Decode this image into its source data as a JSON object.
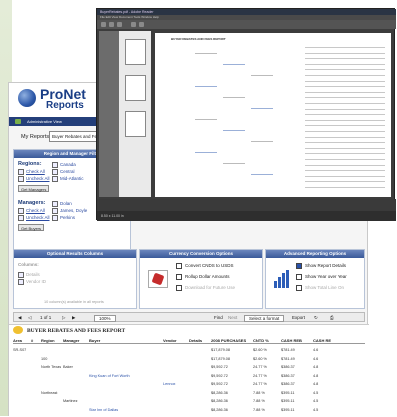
{
  "app": {
    "logo_text": "ProNet",
    "logo_sub": "Reports",
    "admin_label": "Administrative View",
    "my_reports_label": "My Reports:",
    "report_select_value": "Buyer Rebates and Fees"
  },
  "region_panel": {
    "title": "Region and Manager Filter",
    "regions_label": "Regions:",
    "regions": [
      "Canada",
      "Central",
      "Mid-Atlantic"
    ],
    "region_links": [
      "Check All",
      "Uncheck All"
    ],
    "regions_button": "Get Managers",
    "managers_label": "Managers:",
    "managers": [
      "Dolan",
      "James, Doyle",
      "Perkins"
    ],
    "manager_links": [
      "Check All",
      "Uncheck All"
    ],
    "managers_button": "Get Buyers"
  },
  "options": {
    "optional_title": "Optional Results Columns",
    "columns_label": "Columns:",
    "columns": [
      "Details",
      "Vendor ID"
    ],
    "optional_note": "10 column(s) available in all reports",
    "currency_title": "Currency Conversion Options",
    "currency_checks": [
      "Convert CNDS to USDS",
      "Rollup Dollar Amounts",
      "Download for Future Use"
    ],
    "advanced_title": "Advanced Reporting Options",
    "advanced_checks": [
      "Show Report Details",
      "Show Year over Year",
      "Show Total Line On"
    ]
  },
  "toolbar": {
    "page_info": "1 of 1",
    "zoom": "100%",
    "find": "Find",
    "next": "Next",
    "format": "Select a format",
    "export": "Export"
  },
  "report": {
    "title": "BUYER REBATES AND FEES REPORT",
    "columns": [
      "Area",
      "#",
      "Region",
      "Manager",
      "Buyer",
      "Vendor",
      "Details",
      "2008 PURCHASES",
      "CNTD %",
      "CASH REB",
      "CASH RE"
    ],
    "rows": [
      {
        "area": "SR-S07",
        "region": "",
        "manager": "",
        "buyer": "",
        "vendor": "",
        "purchases": "$17,879.08",
        "cntd": "$2.60 %",
        "cash": "$781.49",
        "cash2": "4.6"
      },
      {
        "area": "",
        "region": "100",
        "manager": "",
        "buyer": "",
        "vendor": "",
        "purchases": "$17,879.08",
        "cntd": "$2.60 %",
        "cash": "$781.49",
        "cash2": "4.6"
      },
      {
        "area": "",
        "region": "North Texas",
        "manager": "Baker",
        "buyer": "",
        "vendor": "",
        "purchases": "$9,592.72",
        "cntd": "24.77 %",
        "cash": "$386.37",
        "cash2": "4.8"
      },
      {
        "area": "",
        "region": "",
        "manager": "",
        "buyer": "King Kuan of Fort Worth",
        "vendor": "",
        "purchases": "$9,592.72",
        "cntd": "24.77 %",
        "cash": "$386.37",
        "cash2": "4.8"
      },
      {
        "area": "",
        "region": "",
        "manager": "",
        "buyer": "",
        "vendor": "Lennox",
        "purchases": "$9,592.72",
        "cntd": "24.77 %",
        "cash": "$386.37",
        "cash2": "4.8"
      },
      {
        "area": "",
        "region": "Northeast",
        "manager": "",
        "buyer": "",
        "vendor": "",
        "purchases": "$8,286.36",
        "cntd": "7.88 %",
        "cash": "$395.11",
        "cash2": "4.5"
      },
      {
        "area": "",
        "region": "",
        "manager": "Martinez",
        "buyer": "",
        "vendor": "",
        "purchases": "$8,286.36",
        "cntd": "7.88 %",
        "cash": "$395.11",
        "cash2": "4.5"
      },
      {
        "area": "",
        "region": "",
        "manager": "",
        "buyer": "Star Inn of Dallas",
        "vendor": "",
        "purchases": "$8,286.36",
        "cntd": "7.88 %",
        "cash": "$395.11",
        "cash2": "4.5"
      }
    ]
  },
  "pdf": {
    "title": "BuyerRebates.pdf - Adobe Reader",
    "menu": "File  Edit  View  Document  Tools  Window  Help",
    "heading": "BUYER REBATES AND FEES REPORT",
    "status": "8.50 x 11.00 in"
  },
  "colors": {
    "brand_blue": "#243f7a",
    "panel_header": "#3a5a9a",
    "link_blue": "#2a51a8"
  }
}
